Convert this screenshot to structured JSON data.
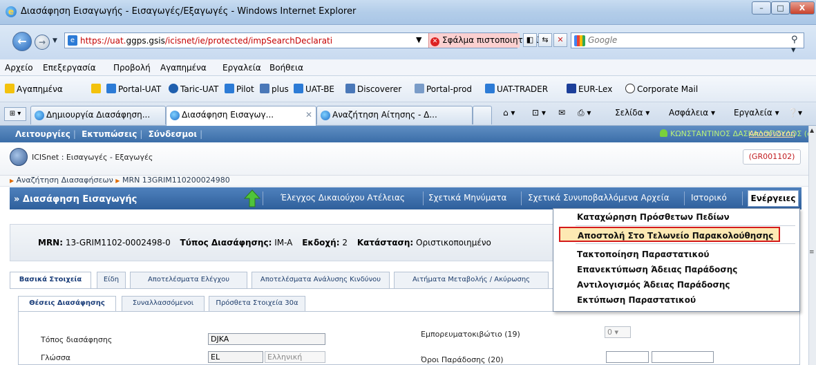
{
  "window": {
    "title": "Διασάφηση Εισαγωγής - Εισαγωγές/Εξαγωγές - Windows Internet Explorer",
    "min": "–",
    "max": "□",
    "close": "X"
  },
  "address": {
    "url_prefix": "https://uat.",
    "url_domain": "ggps.gsis",
    "url_rest": "/icisnet/ie/protected/impSearchDeclarati",
    "cert_error": "Σφάλμα πιστοποιητικού",
    "search_placeholder": "Google"
  },
  "menu": [
    "Αρχείο",
    "Επεξεργασία",
    "Προβολή",
    "Αγαπημένα",
    "Εργαλεία",
    "Βοήθεια"
  ],
  "favorites": {
    "label": "Αγαπημένα",
    "items": [
      "Portal-UAT",
      "Taric-UAT",
      "Pilot",
      "plus",
      "UAT-BE",
      "Discoverer",
      "Portal-prod",
      "UAT-TRADER",
      "EUR-Lex",
      "Corporate Mail"
    ]
  },
  "browser_tabs": [
    "Δημιουργία Διασάφηση...",
    "Διασάφηση Εισαγωγ...",
    "Αναζήτηση Αίτησης - Δ..."
  ],
  "command_bar": {
    "page": "Σελίδα ▾",
    "safety": "Ασφάλεια ▾",
    "tools": "Εργαλεία ▾"
  },
  "app_nav": {
    "functions": "Λειτουργίες",
    "prints": "Εκτυπώσεις",
    "links": "Σύνδεσμοι"
  },
  "user": {
    "name": "ΚΩΝΣΤΑΝΤΙΝΟΣ ΔΑΣΚΑΛΟΠΟΥΛΟΣ (elek1102)",
    "logout": "Αποσύνδεση"
  },
  "app": {
    "title": "ICISnet : Εισαγωγές - Εξαγωγές",
    "office_code": "(GR001102)"
  },
  "breadcrumb": {
    "item1": "Αναζήτηση Διασαφήσεων",
    "item2": "MRN 13GRIM110200024980"
  },
  "section": {
    "title": "» Διασάφηση Εισαγωγής",
    "buttons": [
      "Έλεγχος Δικαιούχου Ατέλειας",
      "Σχετικά Μηνύματα",
      "Σχετικά Συνυποβαλλόμενα Αρχεία",
      "Ιστορικό"
    ],
    "actions": "Ενέργειες"
  },
  "summary": {
    "mrn_label": "MRN:",
    "mrn_value": "13-GRIM1102-0002498-0",
    "type_label": "Τύπος Διασάφησης:",
    "type_value": "IM-A",
    "version_label": "Εκδοχή:",
    "version_value": "2",
    "status_label": "Κατάσταση:",
    "status_value": "Οριστικοποιημένο"
  },
  "main_tabs": [
    "Βασικά Στοιχεία",
    "Είδη",
    "Αποτελέσματα Ελέγχου",
    "Αποτελέσματα Ανάλυσης Κινδύνου",
    "Αιτήματα Μεταβολής / Ακύρωσης"
  ],
  "sub_tabs": [
    "Θέσεις Διασάφησης",
    "Συναλλασσόμενοι",
    "Πρόσθετα Στοιχεία 30α"
  ],
  "form": {
    "place_label": "Τόπος διασάφησης",
    "place_value": "DJKA",
    "lang_label": "Γλώσσα",
    "lang_code": "EL",
    "lang_name": "Ελληνική",
    "container_label": "Εμπορευματοκιβώτιο (19)",
    "container_value": "0",
    "delivery_label": "Όροι Παράδοσης (20)"
  },
  "actions_menu": [
    "Καταχώρηση Πρόσθετων Πεδίων",
    "Αποστολή Στο Τελωνείο Παρακολούθησης",
    "Τακτοποίηση Παραστατικού",
    "Επανεκτύπωση Άδειας Παράδοσης",
    "Αντιλογισμός Άδειας Παράδοσης",
    "Εκτύπωση Παραστατικού"
  ]
}
